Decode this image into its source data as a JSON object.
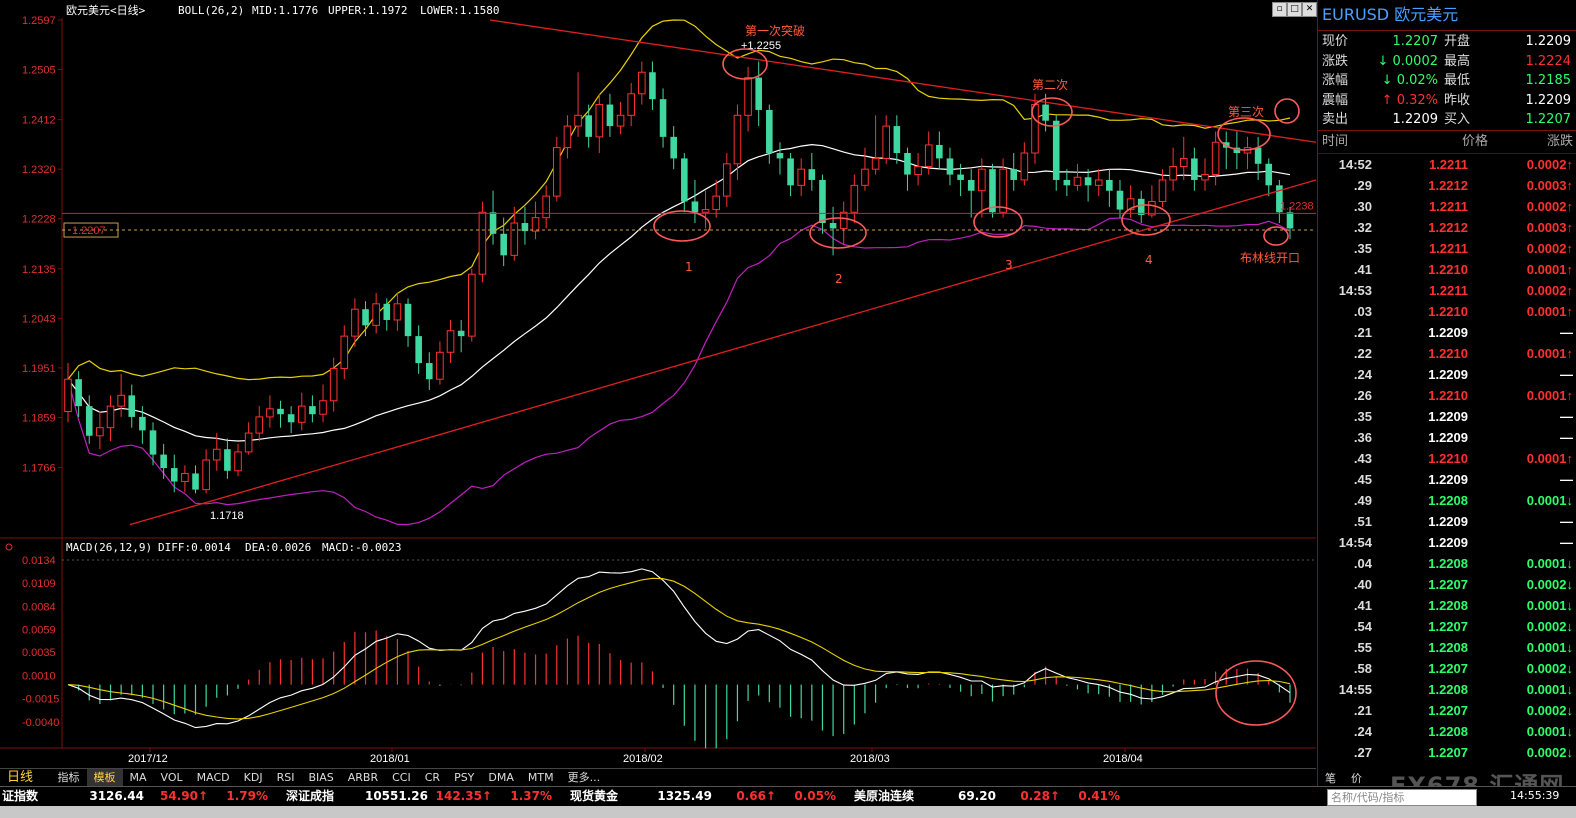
{
  "header": {
    "symbol_label": "欧元美元<日线>",
    "boll_label": "BOLL(26,2)",
    "mid_label": "MID:1.1776",
    "upper_label": "UPPER:1.1972",
    "lower_label": "LOWER:1.1580",
    "macd_header": "MACD(26,12,9)",
    "diff_label": "DIFF:0.0014",
    "dea_label": "DEA:0.0026",
    "macd_label": "MACD:-0.0023"
  },
  "colors": {
    "up": "#ff3030",
    "down": "#40d8a0",
    "mid": "#ffffff",
    "upper": "#e8d200",
    "lower": "#c020c0",
    "trend": "#e02020",
    "annotation": "#ff5a3a"
  },
  "chart_data": [
    {
      "type": "candlestick",
      "title": "欧元美元<日线>",
      "y_ticks": [
        "1.2597",
        "1.2505",
        "1.2412",
        "1.2320",
        "1.2228",
        "1.2135",
        "1.2043",
        "1.1951",
        "1.1859",
        "1.1766"
      ],
      "ylim": [
        1.165,
        1.2597
      ],
      "x_ticks": [
        "2017/12",
        "2018/01",
        "2018/02",
        "2018/03",
        "2018/04"
      ],
      "current_price_box": "1.2207",
      "price_line_label": "1.2238",
      "annotations": [
        "第一次突破",
        "+1.2255",
        "第二次",
        "第三次",
        "布林线开口",
        "1",
        "2",
        "3",
        "4",
        "1.1718"
      ],
      "candles": [
        [
          1.187,
          1.193,
          1.196,
          1.185
        ],
        [
          1.193,
          1.188,
          1.1945,
          1.186
        ],
        [
          1.188,
          1.1825,
          1.19,
          1.181
        ],
        [
          1.1825,
          1.184,
          1.187,
          1.18
        ],
        [
          1.184,
          1.188,
          1.19,
          1.1815
        ],
        [
          1.188,
          1.19,
          1.194,
          1.186
        ],
        [
          1.19,
          1.186,
          1.192,
          1.184
        ],
        [
          1.186,
          1.1835,
          1.188,
          1.181
        ],
        [
          1.1835,
          1.179,
          1.185,
          1.177
        ],
        [
          1.179,
          1.1765,
          1.181,
          1.1745
        ],
        [
          1.1765,
          1.174,
          1.179,
          1.172
        ],
        [
          1.174,
          1.1755,
          1.177,
          1.172
        ],
        [
          1.1755,
          1.1725,
          1.177,
          1.1718
        ],
        [
          1.1725,
          1.178,
          1.18,
          1.1718
        ],
        [
          1.178,
          1.18,
          1.183,
          1.176
        ],
        [
          1.18,
          1.176,
          1.182,
          1.1745
        ],
        [
          1.176,
          1.1795,
          1.181,
          1.175
        ],
        [
          1.1795,
          1.183,
          1.185,
          1.179
        ],
        [
          1.183,
          1.186,
          1.188,
          1.1815
        ],
        [
          1.186,
          1.1875,
          1.19,
          1.184
        ],
        [
          1.1875,
          1.1865,
          1.189,
          1.184
        ],
        [
          1.1865,
          1.185,
          1.188,
          1.183
        ],
        [
          1.185,
          1.188,
          1.1905,
          1.1835
        ],
        [
          1.188,
          1.1865,
          1.19,
          1.185
        ],
        [
          1.1865,
          1.189,
          1.192,
          1.185
        ],
        [
          1.189,
          1.195,
          1.197,
          1.187
        ],
        [
          1.195,
          1.201,
          1.203,
          1.193
        ],
        [
          1.201,
          1.206,
          1.208,
          1.199
        ],
        [
          1.206,
          1.203,
          1.2075,
          1.201
        ],
        [
          1.203,
          1.207,
          1.209,
          1.2015
        ],
        [
          1.207,
          1.204,
          1.208,
          1.202
        ],
        [
          1.204,
          1.207,
          1.209,
          1.202
        ],
        [
          1.207,
          1.201,
          1.208,
          1.199
        ],
        [
          1.201,
          1.196,
          1.203,
          1.194
        ],
        [
          1.196,
          1.193,
          1.198,
          1.191
        ],
        [
          1.193,
          1.198,
          1.2,
          1.192
        ],
        [
          1.198,
          1.202,
          1.204,
          1.196
        ],
        [
          1.202,
          1.201,
          1.204,
          1.198
        ],
        [
          1.201,
          1.2125,
          1.2135,
          1.2
        ],
        [
          1.2125,
          1.224,
          1.226,
          1.211
        ],
        [
          1.224,
          1.22,
          1.228,
          1.218
        ],
        [
          1.22,
          1.216,
          1.223,
          1.214
        ],
        [
          1.216,
          1.222,
          1.225,
          1.215
        ],
        [
          1.222,
          1.2205,
          1.225,
          1.218
        ],
        [
          1.2205,
          1.223,
          1.226,
          1.219
        ],
        [
          1.223,
          1.227,
          1.229,
          1.221
        ],
        [
          1.227,
          1.236,
          1.238,
          1.226
        ],
        [
          1.236,
          1.24,
          1.242,
          1.234
        ],
        [
          1.24,
          1.242,
          1.25,
          1.238
        ],
        [
          1.242,
          1.238,
          1.244,
          1.236
        ],
        [
          1.238,
          1.244,
          1.246,
          1.235
        ],
        [
          1.244,
          1.24,
          1.246,
          1.238
        ],
        [
          1.24,
          1.242,
          1.2445,
          1.2385
        ],
        [
          1.242,
          1.246,
          1.248,
          1.24
        ],
        [
          1.246,
          1.25,
          1.252,
          1.244
        ],
        [
          1.25,
          1.245,
          1.252,
          1.243
        ],
        [
          1.245,
          1.238,
          1.247,
          1.236
        ],
        [
          1.238,
          1.234,
          1.24,
          1.232
        ],
        [
          1.234,
          1.226,
          1.235,
          1.224
        ],
        [
          1.226,
          1.224,
          1.23,
          1.222
        ],
        [
          1.224,
          1.2245,
          1.228,
          1.221
        ],
        [
          1.2245,
          1.227,
          1.23,
          1.223
        ],
        [
          1.227,
          1.233,
          1.235,
          1.225
        ],
        [
          1.233,
          1.242,
          1.244,
          1.23
        ],
        [
          1.242,
          1.249,
          1.251,
          1.239
        ],
        [
          1.249,
          1.243,
          1.252,
          1.24
        ],
        [
          1.243,
          1.235,
          1.244,
          1.233
        ],
        [
          1.235,
          1.234,
          1.237,
          1.231
        ],
        [
          1.234,
          1.229,
          1.235,
          1.227
        ],
        [
          1.229,
          1.232,
          1.234,
          1.227
        ],
        [
          1.232,
          1.23,
          1.235,
          1.228
        ],
        [
          1.23,
          1.222,
          1.231,
          1.22
        ],
        [
          1.222,
          1.221,
          1.225,
          1.216
        ],
        [
          1.221,
          1.224,
          1.226,
          1.218
        ],
        [
          1.224,
          1.229,
          1.231,
          1.222
        ],
        [
          1.229,
          1.232,
          1.236,
          1.228
        ],
        [
          1.232,
          1.234,
          1.242,
          1.231
        ],
        [
          1.234,
          1.24,
          1.242,
          1.233
        ],
        [
          1.24,
          1.235,
          1.242,
          1.233
        ],
        [
          1.235,
          1.231,
          1.236,
          1.228
        ],
        [
          1.231,
          1.2325,
          1.235,
          1.229
        ],
        [
          1.2325,
          1.2365,
          1.239,
          1.231
        ],
        [
          1.2365,
          1.234,
          1.239,
          1.232
        ],
        [
          1.234,
          1.231,
          1.236,
          1.229
        ],
        [
          1.231,
          1.23,
          1.233,
          1.227
        ],
        [
          1.23,
          1.228,
          1.232,
          1.223
        ],
        [
          1.228,
          1.232,
          1.234,
          1.223
        ],
        [
          1.232,
          1.224,
          1.233,
          1.223
        ],
        [
          1.224,
          1.232,
          1.234,
          1.223
        ],
        [
          1.232,
          1.23,
          1.235,
          1.228
        ],
        [
          1.23,
          1.235,
          1.237,
          1.229
        ],
        [
          1.235,
          1.244,
          1.246,
          1.233
        ],
        [
          1.244,
          1.241,
          1.246,
          1.239
        ],
        [
          1.241,
          1.23,
          1.242,
          1.228
        ],
        [
          1.23,
          1.229,
          1.232,
          1.227
        ],
        [
          1.229,
          1.2305,
          1.233,
          1.228
        ],
        [
          1.2305,
          1.229,
          1.232,
          1.226
        ],
        [
          1.229,
          1.23,
          1.232,
          1.227
        ],
        [
          1.23,
          1.228,
          1.232,
          1.225
        ],
        [
          1.228,
          1.2245,
          1.23,
          1.223
        ],
        [
          1.2245,
          1.2265,
          1.229,
          1.223
        ],
        [
          1.2265,
          1.2235,
          1.228,
          1.222
        ],
        [
          1.2235,
          1.226,
          1.229,
          1.223
        ],
        [
          1.226,
          1.23,
          1.232,
          1.225
        ],
        [
          1.23,
          1.2325,
          1.236,
          1.228
        ],
        [
          1.2325,
          1.234,
          1.238,
          1.23
        ],
        [
          1.234,
          1.23,
          1.236,
          1.228
        ],
        [
          1.23,
          1.231,
          1.234,
          1.228
        ],
        [
          1.231,
          1.237,
          1.239,
          1.229
        ],
        [
          1.237,
          1.236,
          1.239,
          1.232
        ],
        [
          1.236,
          1.235,
          1.239,
          1.232
        ],
        [
          1.235,
          1.236,
          1.238,
          1.232
        ],
        [
          1.236,
          1.233,
          1.238,
          1.23
        ],
        [
          1.233,
          1.229,
          1.234,
          1.227
        ],
        [
          1.229,
          1.224,
          1.23,
          1.222
        ],
        [
          1.224,
          1.221,
          1.225,
          1.219
        ]
      ]
    },
    {
      "type": "macd",
      "title": "MACD(26,12,9)",
      "y_ticks": [
        "0.0134",
        "0.0109",
        "0.0084",
        "0.0059",
        "0.0035",
        "0.0010",
        "-0.0015",
        "-0.0040"
      ],
      "ylim": [
        -0.0065,
        0.0134
      ]
    }
  ],
  "panel": {
    "title": "EURUSD 欧元美元",
    "quote": [
      {
        "label": "现价",
        "value": "1.2207",
        "vc": "dn",
        "label2": "开盘",
        "value2": "1.2209",
        "v2c": "wh"
      },
      {
        "label": "涨跌",
        "value": "↓ 0.0002",
        "vc": "dn",
        "label2": "最高",
        "value2": "1.2224",
        "v2c": "up"
      },
      {
        "label": "涨幅",
        "value": "↓ 0.02%",
        "vc": "dn",
        "label2": "最低",
        "value2": "1.2185",
        "v2c": "dn"
      },
      {
        "label": "震幅",
        "value": "↑ 0.32%",
        "vc": "up",
        "label2": "昨收",
        "value2": "1.2209",
        "v2c": "wh"
      },
      {
        "label": "卖出",
        "value": "1.2209",
        "vc": "wh",
        "label2": "买入",
        "value2": "1.2207",
        "v2c": "dn"
      }
    ],
    "table_headers": [
      "时间",
      "价格",
      "涨跌"
    ],
    "ticks": [
      {
        "t": "14:52",
        "p": "1.2211",
        "c": "0.0002↑",
        "cls": "up"
      },
      {
        "t": ".29",
        "p": "1.2212",
        "c": "0.0003↑",
        "cls": "up"
      },
      {
        "t": ".30",
        "p": "1.2211",
        "c": "0.0002↑",
        "cls": "up"
      },
      {
        "t": ".32",
        "p": "1.2212",
        "c": "0.0003↑",
        "cls": "up"
      },
      {
        "t": ".35",
        "p": "1.2211",
        "c": "0.0002↑",
        "cls": "up"
      },
      {
        "t": ".41",
        "p": "1.2210",
        "c": "0.0001↑",
        "cls": "up"
      },
      {
        "t": "14:53",
        "p": "1.2211",
        "c": "0.0002↑",
        "cls": "up"
      },
      {
        "t": ".03",
        "p": "1.2210",
        "c": "0.0001↑",
        "cls": "up"
      },
      {
        "t": ".21",
        "p": "1.2209",
        "c": "—",
        "cls": "wh"
      },
      {
        "t": ".22",
        "p": "1.2210",
        "c": "0.0001↑",
        "cls": "up"
      },
      {
        "t": ".24",
        "p": "1.2209",
        "c": "—",
        "cls": "wh"
      },
      {
        "t": ".26",
        "p": "1.2210",
        "c": "0.0001↑",
        "cls": "up"
      },
      {
        "t": ".35",
        "p": "1.2209",
        "c": "—",
        "cls": "wh"
      },
      {
        "t": ".36",
        "p": "1.2209",
        "c": "—",
        "cls": "wh"
      },
      {
        "t": ".43",
        "p": "1.2210",
        "c": "0.0001↑",
        "cls": "up"
      },
      {
        "t": ".45",
        "p": "1.2209",
        "c": "—",
        "cls": "wh"
      },
      {
        "t": ".49",
        "p": "1.2208",
        "c": "0.0001↓",
        "cls": "dn"
      },
      {
        "t": ".51",
        "p": "1.2209",
        "c": "—",
        "cls": "wh"
      },
      {
        "t": "14:54",
        "p": "1.2209",
        "c": "—",
        "cls": "wh"
      },
      {
        "t": ".04",
        "p": "1.2208",
        "c": "0.0001↓",
        "cls": "dn"
      },
      {
        "t": ".40",
        "p": "1.2207",
        "c": "0.0002↓",
        "cls": "dn"
      },
      {
        "t": ".41",
        "p": "1.2208",
        "c": "0.0001↓",
        "cls": "dn"
      },
      {
        "t": ".54",
        "p": "1.2207",
        "c": "0.0002↓",
        "cls": "dn"
      },
      {
        "t": ".55",
        "p": "1.2208",
        "c": "0.0001↓",
        "cls": "dn"
      },
      {
        "t": ".58",
        "p": "1.2207",
        "c": "0.0002↓",
        "cls": "dn"
      },
      {
        "t": "14:55",
        "p": "1.2208",
        "c": "0.0001↓",
        "cls": "dn"
      },
      {
        "t": ".21",
        "p": "1.2207",
        "c": "0.0002↓",
        "cls": "dn"
      },
      {
        "t": ".24",
        "p": "1.2208",
        "c": "0.0001↓",
        "cls": "dn"
      },
      {
        "t": ".27",
        "p": "1.2207",
        "c": "0.0002↓",
        "cls": "dn"
      }
    ],
    "foot_left": "笔",
    "foot_right": "价",
    "search_placeholder": "名称/代码/指标",
    "clock": "14:55:39",
    "watermark": "FX678 汇通网"
  },
  "tabbar": {
    "period": "日线",
    "tabs": [
      "指标",
      "模板",
      "MA",
      "VOL",
      "MACD",
      "KDJ",
      "RSI",
      "BIAS",
      "ARBR",
      "CCI",
      "CR",
      "PSY",
      "DMA",
      "MTM",
      "更多..."
    ]
  },
  "status": [
    {
      "name": "证指数",
      "v1": "3126.44",
      "v2": "54.90↑",
      "v3": "1.79%"
    },
    {
      "name": "深证成指",
      "v1": "10551.26",
      "v2": "142.35↑",
      "v3": "1.37%"
    },
    {
      "name": "现货黄金",
      "v1": "1325.49",
      "v2": "0.66↑",
      "v3": "0.05%"
    },
    {
      "name": "美原油连续",
      "v1": "69.20",
      "v2": "0.28↑",
      "v3": "0.41%"
    }
  ]
}
